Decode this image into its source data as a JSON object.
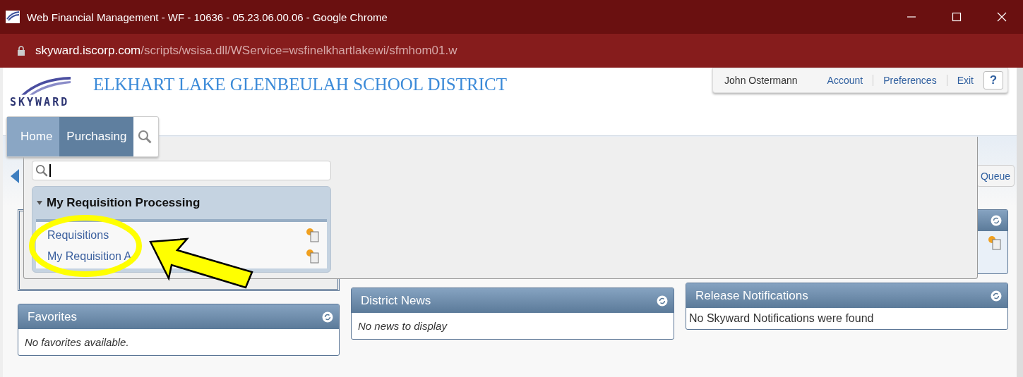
{
  "window": {
    "title": "Web Financial Management - WF - 10636 - 05.23.06.00.06 - Google Chrome"
  },
  "address_bar": {
    "host": "skyward.iscorp.com",
    "path": "/scripts/wsisa.dll/WService=wsfinelkhartlakewi/sfmhom01.w"
  },
  "header": {
    "logo": "SKYWARD",
    "district": "ELKHART LAKE GLENBEULAH SCHOOL DISTRICT"
  },
  "user_bar": {
    "user": "John Ostermann",
    "links": [
      "Account",
      "Preferences",
      "Exit"
    ],
    "help": "?"
  },
  "nav_tabs": [
    {
      "label": "Home",
      "selected": false
    },
    {
      "label": "Purchasing",
      "selected": true
    }
  ],
  "menu": {
    "group": {
      "title": "My Requisition Processing",
      "expanded": true,
      "items": [
        "Requisitions",
        "My Requisition A"
      ]
    }
  },
  "queue_button": "Queue",
  "panels": [
    {
      "title": "Favorites",
      "body": "No favorites available."
    },
    {
      "title": "District News",
      "body": "No news to display"
    },
    {
      "title": "Release Notifications",
      "body": "No Skyward Notifications were found"
    }
  ],
  "annotation": {
    "circle": true,
    "arrow": true
  }
}
